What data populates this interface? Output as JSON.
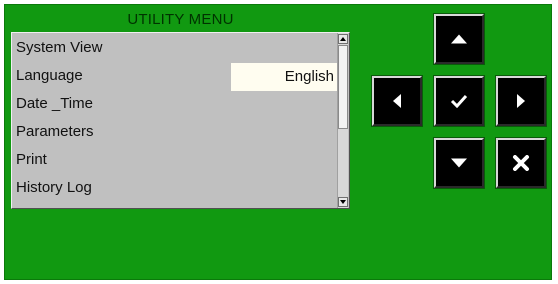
{
  "menu": {
    "title": "UTILITY MENU",
    "items": [
      {
        "label": "System View",
        "value": ""
      },
      {
        "label": "Language",
        "value": "English"
      },
      {
        "label": "Date _Time",
        "value": ""
      },
      {
        "label": "Parameters",
        "value": ""
      },
      {
        "label": "Print",
        "value": ""
      },
      {
        "label": "History Log",
        "value": ""
      }
    ]
  },
  "icons": {
    "up": "arrow-up-icon",
    "left": "arrow-left-icon",
    "ok": "checkmark-icon",
    "right": "arrow-right-icon",
    "down": "arrow-down-icon",
    "cancel": "x-icon"
  },
  "colors": {
    "background": "#119911",
    "panel": "#c0c0c0",
    "selected_value_bg": "#fffdf0",
    "button": "#000000",
    "button_icon": "#ffffff"
  }
}
